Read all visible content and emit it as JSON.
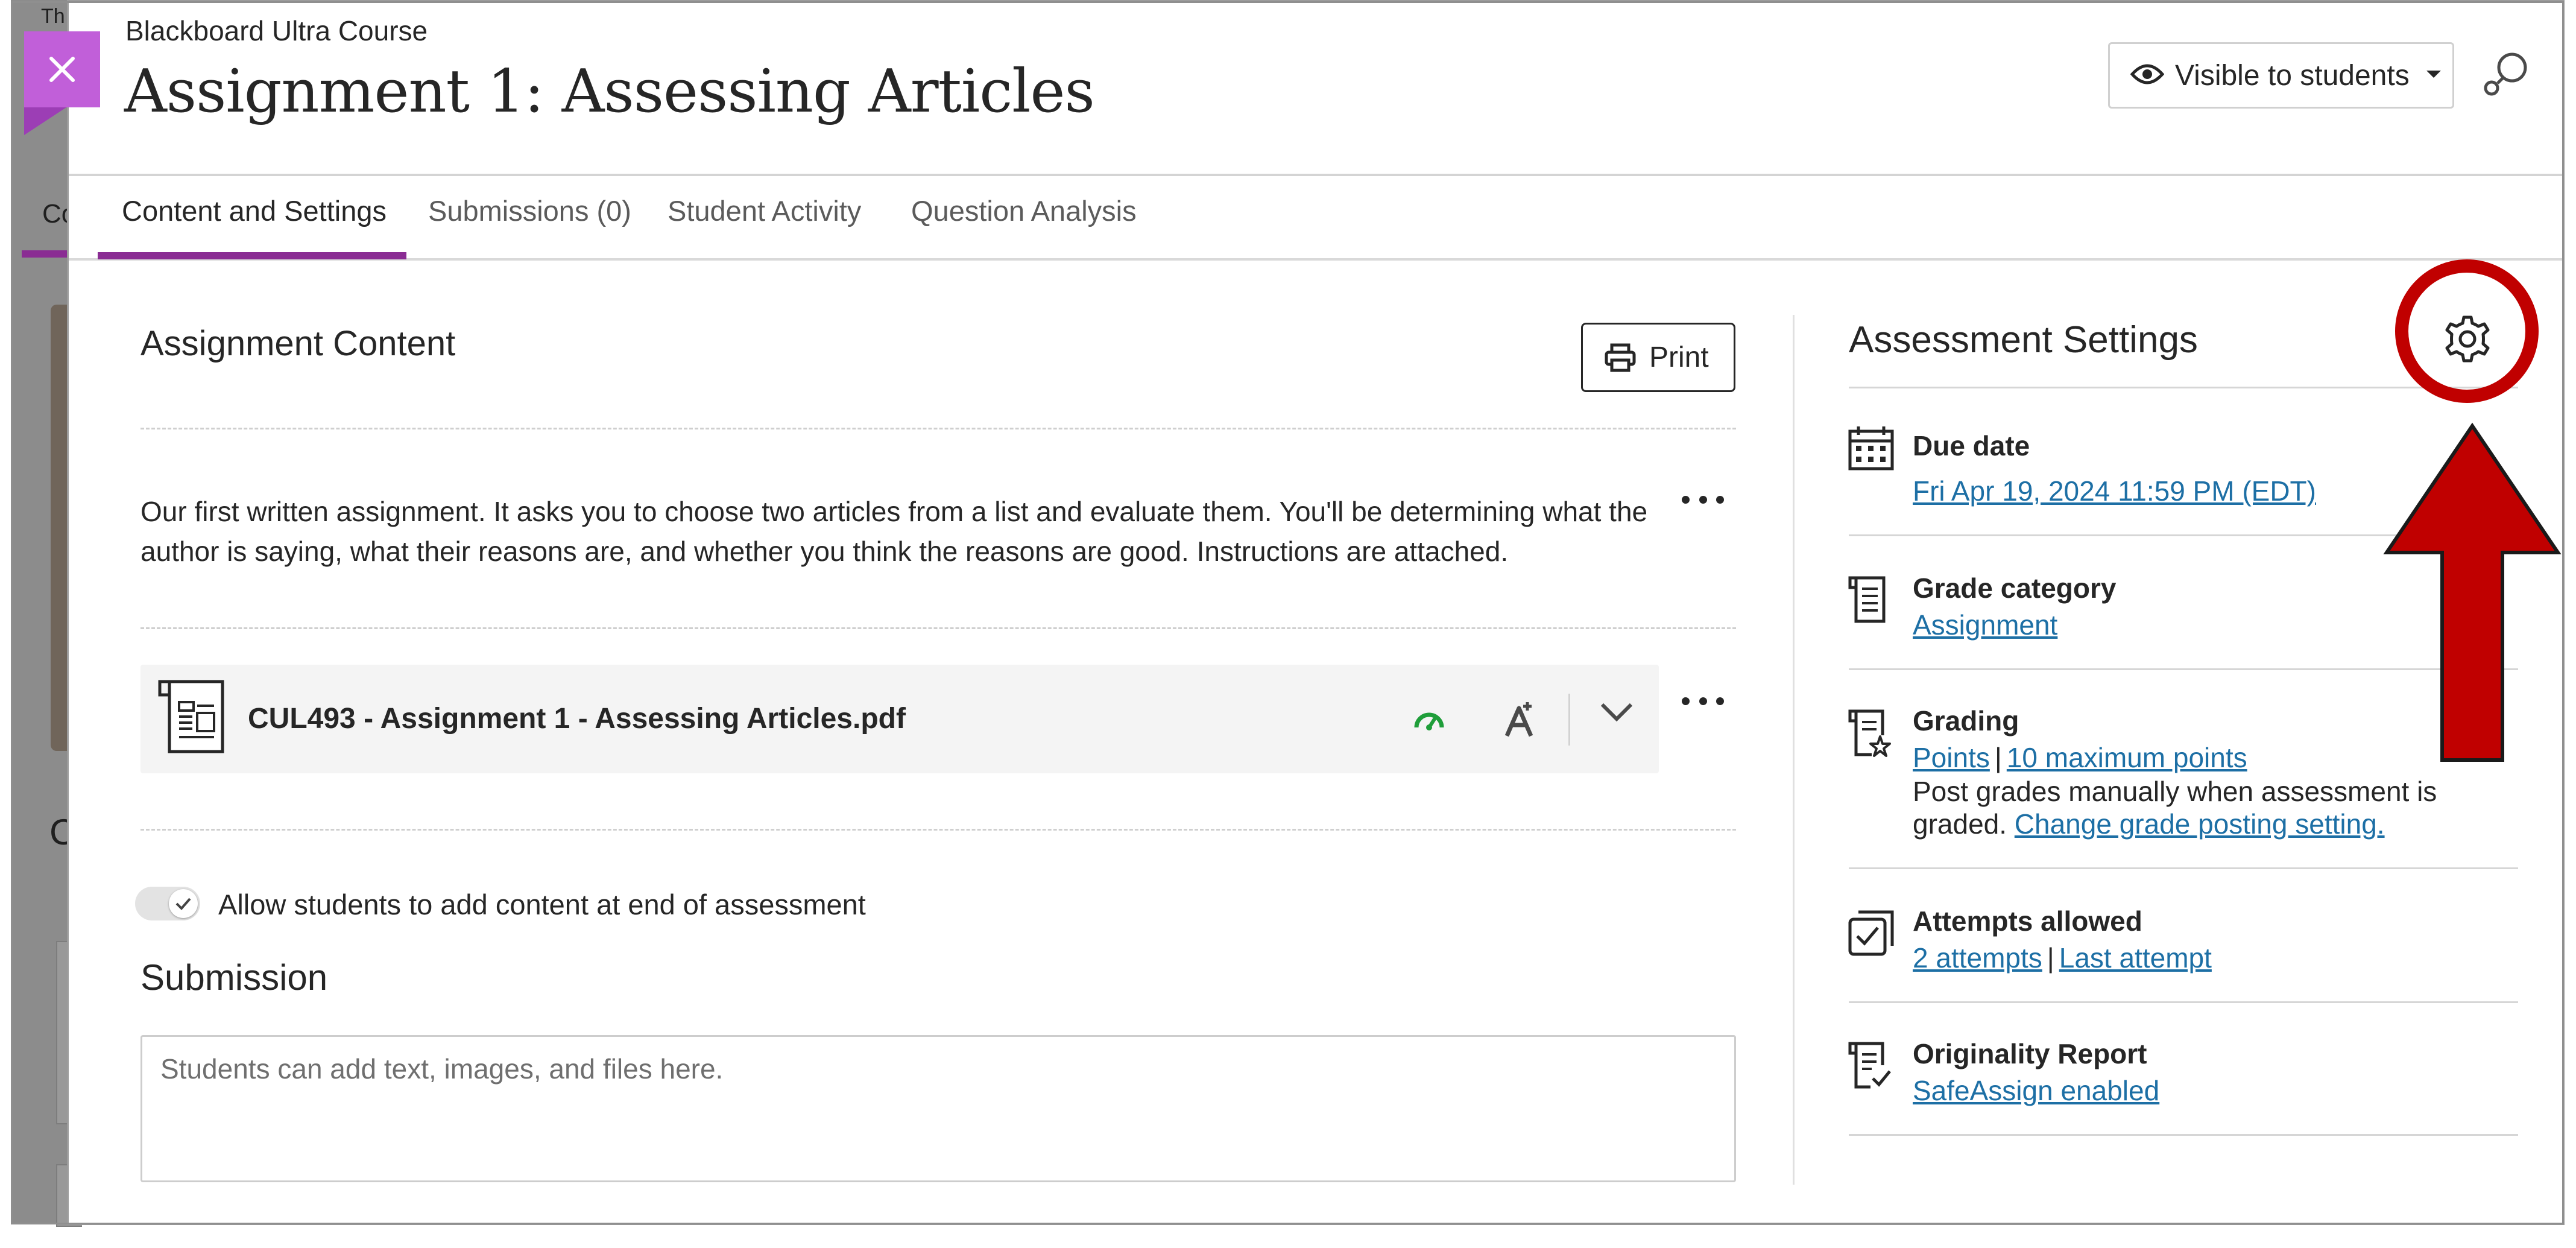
{
  "course_name": "Blackboard Ultra Course",
  "title": "Assignment 1: Assessing Articles",
  "visibility": {
    "label": "Visible to students"
  },
  "tabs": [
    {
      "label": "Content and Settings",
      "active": true
    },
    {
      "label": "Submissions (0)",
      "active": false
    },
    {
      "label": "Student Activity",
      "active": false
    },
    {
      "label": "Question Analysis",
      "active": false
    }
  ],
  "content": {
    "heading": "Assignment Content",
    "print_label": "Print",
    "description": "Our first written assignment. It asks you to choose two articles from a list and evaluate them. You'll be determining what the author is saying, what their reasons are, and whether you think the reasons are good. Instructions are attached.",
    "file_name": "CUL493 - Assignment 1 - Assessing Articles.pdf",
    "toggle_label": "Allow students to add content at end of assessment",
    "toggle_on": true,
    "submission_heading": "Submission",
    "submission_placeholder": "Students can add text, images, and files here."
  },
  "settings": {
    "heading": "Assessment Settings",
    "due_date": {
      "label": "Due date",
      "value": "Fri Apr 19, 2024 11:59 PM (EDT)"
    },
    "grade_category": {
      "label": "Grade category",
      "value": "Assignment"
    },
    "grading": {
      "label": "Grading",
      "scheme": "Points",
      "max_points": "10 maximum points",
      "post_text_1": "Post grades manually when assessment is",
      "post_text_2": "graded.",
      "change_link": "Change grade posting setting."
    },
    "attempts": {
      "label": "Attempts allowed",
      "count": "2 attempts",
      "which": "Last attempt"
    },
    "originality": {
      "label": "Originality Report",
      "value": "SafeAssign enabled"
    }
  },
  "background_fragments": {
    "top": "Th",
    "tab": "Co",
    "heading": "C"
  },
  "colors": {
    "accent": "#8a2c93",
    "close_bg": "#c15fd9",
    "link": "#1d6fa5",
    "annotation": "#c00000"
  },
  "icons": [
    "close-icon",
    "eye-icon",
    "caret-down-icon",
    "search-icon",
    "print-icon",
    "more-icon",
    "document-icon",
    "status-icon",
    "accessibility-icon",
    "chevron-down-icon",
    "check-icon",
    "gear-icon",
    "calendar-icon",
    "grade-category-icon",
    "grading-icon",
    "attempts-icon",
    "originality-icon"
  ]
}
